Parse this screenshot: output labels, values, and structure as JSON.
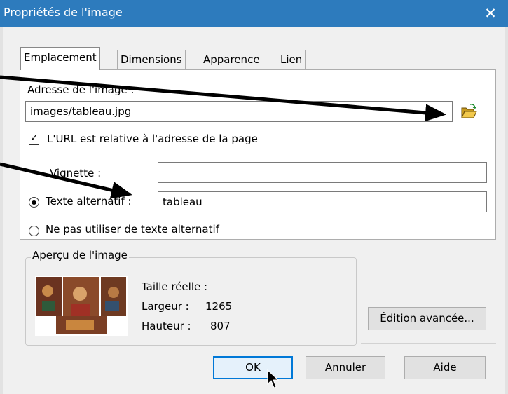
{
  "window": {
    "title": "Propriétés de l'image",
    "close_glyph": "✕"
  },
  "tabs": [
    {
      "label": "Emplacement",
      "active": true
    },
    {
      "label": "Dimensions",
      "active": false
    },
    {
      "label": "Apparence",
      "active": false
    },
    {
      "label": "Lien",
      "active": false
    }
  ],
  "location": {
    "address_label": "Adresse de l'image :",
    "address_value": "images/tableau.jpg",
    "relative_label": "L'URL est relative à l'adresse de la page",
    "relative_checked": true,
    "tooltip_label": "Vignette :",
    "tooltip_value": "",
    "alt_label": "Texte alternatif :",
    "alt_value": "tableau",
    "alt_selected": true,
    "no_alt_label": "Ne pas utiliser de texte alternatif",
    "no_alt_selected": false
  },
  "preview": {
    "legend": "Aperçu de l'image",
    "actual_size_label": "Taille réelle :",
    "width_label": "Largeur :",
    "width_value": "1265",
    "height_label": "Hauteur :",
    "height_value": "807"
  },
  "buttons": {
    "advanced": "Édition avancée...",
    "ok": "OK",
    "cancel": "Annuler",
    "help": "Aide"
  },
  "icons": {
    "folder": "folder-open-icon",
    "close": "close-icon",
    "cursor": "mouse-pointer-icon"
  },
  "colors": {
    "titlebar": "#2d7bbd",
    "default_button_border": "#0078d7"
  }
}
